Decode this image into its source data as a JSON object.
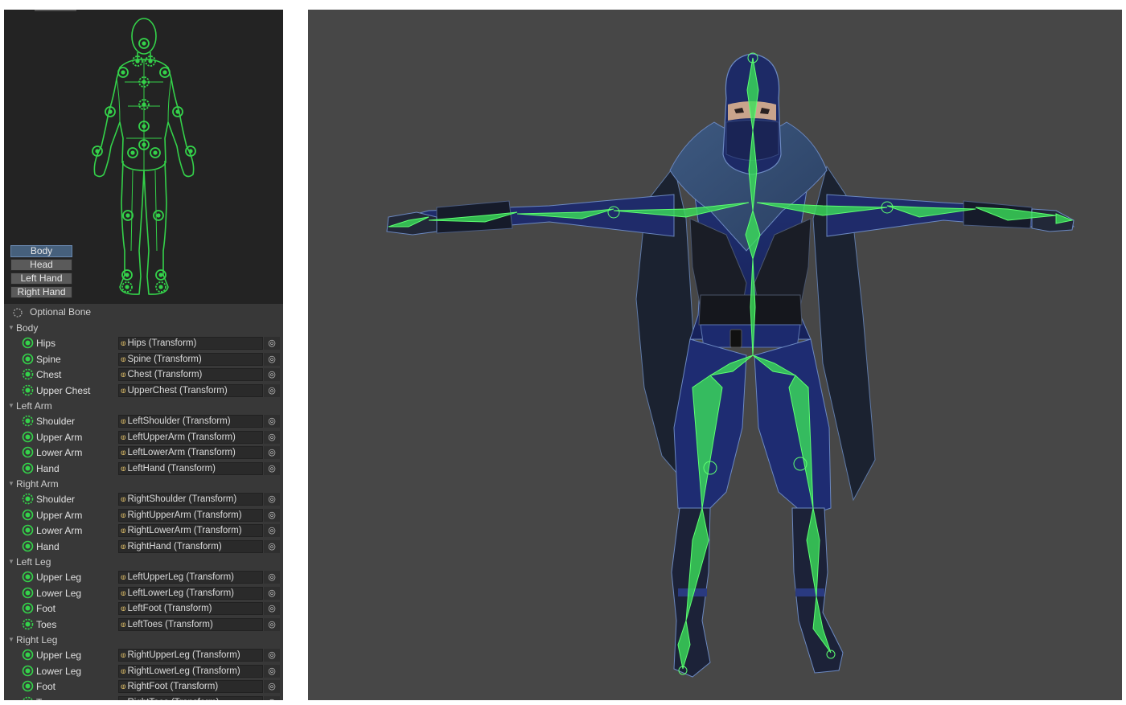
{
  "avatar_tabs": [
    "Body",
    "Head",
    "Left Hand",
    "Right Hand"
  ],
  "active_tab": "Body",
  "optional_bone_label": "Optional Bone",
  "colors": {
    "bone_green": "#34d24a",
    "panel_bg": "#383838",
    "avatar_bg": "#232323",
    "scene_bg": "#474747",
    "active_tab": "#46607c",
    "character_blue": "#1d2a66"
  },
  "groups": [
    {
      "name": "Body",
      "bones": [
        {
          "label": "Hips",
          "value": "Hips (Transform)",
          "optional": false
        },
        {
          "label": "Spine",
          "value": "Spine (Transform)",
          "optional": false
        },
        {
          "label": "Chest",
          "value": "Chest (Transform)",
          "optional": true
        },
        {
          "label": "Upper Chest",
          "value": "UpperChest (Transform)",
          "optional": true
        }
      ]
    },
    {
      "name": "Left Arm",
      "bones": [
        {
          "label": "Shoulder",
          "value": "LeftShoulder (Transform)",
          "optional": true
        },
        {
          "label": "Upper Arm",
          "value": "LeftUpperArm (Transform)",
          "optional": false
        },
        {
          "label": "Lower Arm",
          "value": "LeftLowerArm (Transform)",
          "optional": false
        },
        {
          "label": "Hand",
          "value": "LeftHand (Transform)",
          "optional": false
        }
      ]
    },
    {
      "name": "Right Arm",
      "bones": [
        {
          "label": "Shoulder",
          "value": "RightShoulder (Transform)",
          "optional": true
        },
        {
          "label": "Upper Arm",
          "value": "RightUpperArm (Transform)",
          "optional": false
        },
        {
          "label": "Lower Arm",
          "value": "RightLowerArm (Transform)",
          "optional": false
        },
        {
          "label": "Hand",
          "value": "RightHand (Transform)",
          "optional": false
        }
      ]
    },
    {
      "name": "Left Leg",
      "bones": [
        {
          "label": "Upper Leg",
          "value": "LeftUpperLeg (Transform)",
          "optional": false
        },
        {
          "label": "Lower Leg",
          "value": "LeftLowerLeg (Transform)",
          "optional": false
        },
        {
          "label": "Foot",
          "value": "LeftFoot (Transform)",
          "optional": false
        },
        {
          "label": "Toes",
          "value": "LeftToes (Transform)",
          "optional": true
        }
      ]
    },
    {
      "name": "Right Leg",
      "bones": [
        {
          "label": "Upper Leg",
          "value": "RightUpperLeg (Transform)",
          "optional": false
        },
        {
          "label": "Lower Leg",
          "value": "RightLowerLeg (Transform)",
          "optional": false
        },
        {
          "label": "Foot",
          "value": "RightFoot (Transform)",
          "optional": false
        },
        {
          "label": "Toes",
          "value": "RightToes (Transform)",
          "optional": true
        }
      ]
    }
  ]
}
